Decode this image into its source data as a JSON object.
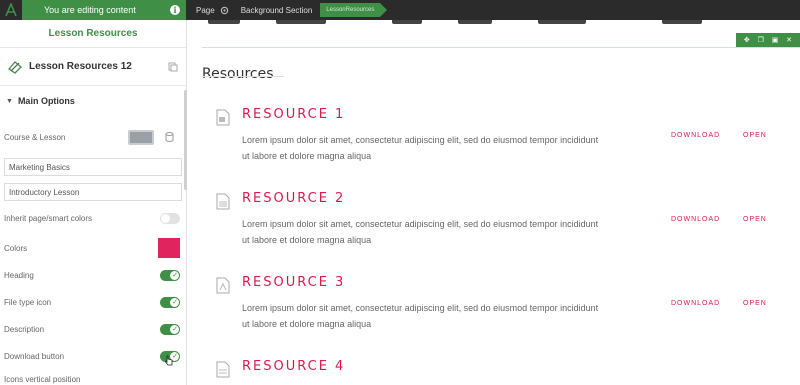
{
  "topbar": {
    "editing_label": "You are editing content",
    "info_label": "i",
    "crumb_page": "Page",
    "crumb_section": "Background Section",
    "crumb_active": "LessonResources"
  },
  "sidebar": {
    "header": "Lesson Resources",
    "module_title": "Lesson Resources 12",
    "section_title": "Main Options",
    "course_lesson_label": "Course & Lesson",
    "course_value": "Marketing Basics",
    "lesson_value": "Introductory Lesson",
    "inherit_label": "Inherit page/smart colors",
    "colors_label": "Colors",
    "heading_label": "Heading",
    "file_type_icon_label": "File type icon",
    "description_label": "Description",
    "download_button_label": "Download button",
    "icons_vertical_label": "Icons vertical position",
    "collapse_arrow": "◀",
    "colors_swatch": "#e0245e"
  },
  "main": {
    "title": "Resources",
    "resources": [
      {
        "name": "RESOURCE 1",
        "desc_line1": "Lorem ipsum dolor sit amet, consectetur adipiscing elit, sed do eiusmod tempor incididunt",
        "desc_line2": "ut labore et dolore magna aliqua",
        "download": "DOWNLOAD",
        "open": "OPEN"
      },
      {
        "name": "RESOURCE 2",
        "desc_line1": "Lorem ipsum dolor sit amet, consectetur adipiscing elit, sed do eiusmod tempor incididunt",
        "desc_line2": "ut labore et dolore magna aliqua",
        "download": "DOWNLOAD",
        "open": "OPEN"
      },
      {
        "name": "RESOURCE 3",
        "desc_line1": "Lorem ipsum dolor sit amet, consectetur adipiscing elit, sed do eiusmod tempor incididunt",
        "desc_line2": "ut labore et dolore magna aliqua",
        "download": "DOWNLOAD",
        "open": "OPEN"
      },
      {
        "name": "RESOURCE 4"
      }
    ],
    "accent_color": "#d81b4e",
    "brand_green": "#3f8f46"
  }
}
